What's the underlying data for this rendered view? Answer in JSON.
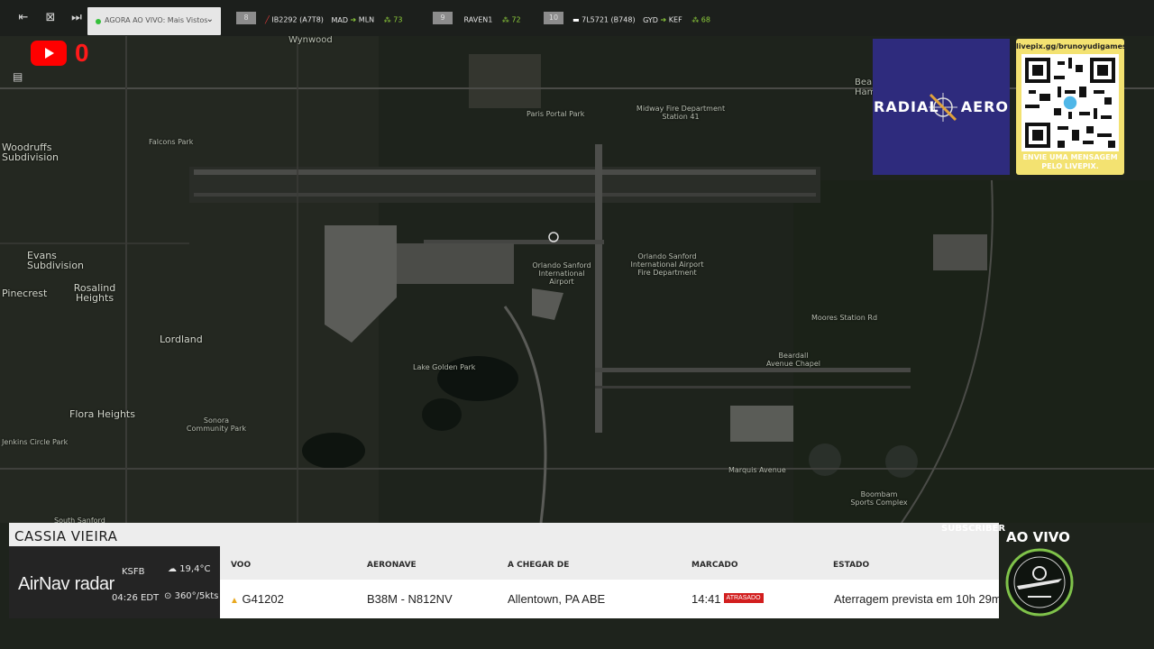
{
  "topbar": {
    "live_label": "AGORA AO VIVO: Mais Vistos",
    "flights": [
      {
        "rank": "8",
        "callsign": "IB2292 (A7T8)",
        "origin": "MAD",
        "dest": "MLN",
        "viewers": "73"
      },
      {
        "rank": "9",
        "callsign": "RAVEN1",
        "viewers": "72"
      },
      {
        "rank": "10",
        "callsign": "7L5721 (B748)",
        "origin": "GYD",
        "dest": "KEF",
        "viewers": "68"
      }
    ]
  },
  "youtube": {
    "count": "0"
  },
  "map_labels": {
    "wynwood": "Wynwood",
    "midway": "Midway Fire Department\nStation 41",
    "paris": "Paris Portal Park",
    "falcons": "Falcons Park",
    "woodruffs": "Woodruffs\nSubdivision",
    "evans": "Evans\nSubdivision",
    "rosalind": "Rosalind\nHeights",
    "pinecrest": "Pinecrest",
    "lordland": "Lordland",
    "flora": "Flora Heights",
    "jenkins": "Jenkins Circle Park",
    "sonora": "Sonora\nCommunity Park",
    "airport": "Orlando Sanford\nInternational\nAirport",
    "fire": "Orlando Sanford\nInternational Airport\nFire Department",
    "lake": "Lake Golden Park",
    "beardall": "Beardall\nAvenue Chapel",
    "moores": "Moores Station Rd",
    "marquis": "Marquis Avenue",
    "boombam": "Boombam\nSports Complex",
    "south": "South Sanford",
    "bear": "Bea\nHamm"
  },
  "sponsor": {
    "left": "RADIAL",
    "right": "AERO"
  },
  "qr": {
    "url": "livepix.gg/brunoyudigames",
    "message": "ENVIE UMA MENSAGEM\nPELO LIVEPIX."
  },
  "panel": {
    "title": "CASSIA VIEIRA",
    "brand_a": "AirNav",
    "brand_b": "radar",
    "icao": "KSFB",
    "local_time": "04:26 EDT",
    "temp": "19,4°C",
    "wind": "360°/5kts",
    "headers": {
      "flight": "VOO",
      "aircraft": "AERONAVE",
      "from": "A CHEGAR DE",
      "scheduled": "MARCADO",
      "status": "ESTADO"
    },
    "row": {
      "flight": "G41202",
      "aircraft": "B38M - N812NV",
      "from": "Allentown, PA ABE",
      "scheduled": "14:41",
      "delay": "ATRASADO",
      "status": "Aterragem prevista em 10h 29m"
    }
  },
  "subscriber_label": "SUBSCRIBER",
  "live_badge": "AO VIVO",
  "colors": {
    "accent_green": "#8fcf3c",
    "youtube_red": "#ff1a1a",
    "sponsor_blue": "#2e2b7d",
    "qr_yellow": "#f3e271",
    "delay_red": "#d21e1e"
  }
}
